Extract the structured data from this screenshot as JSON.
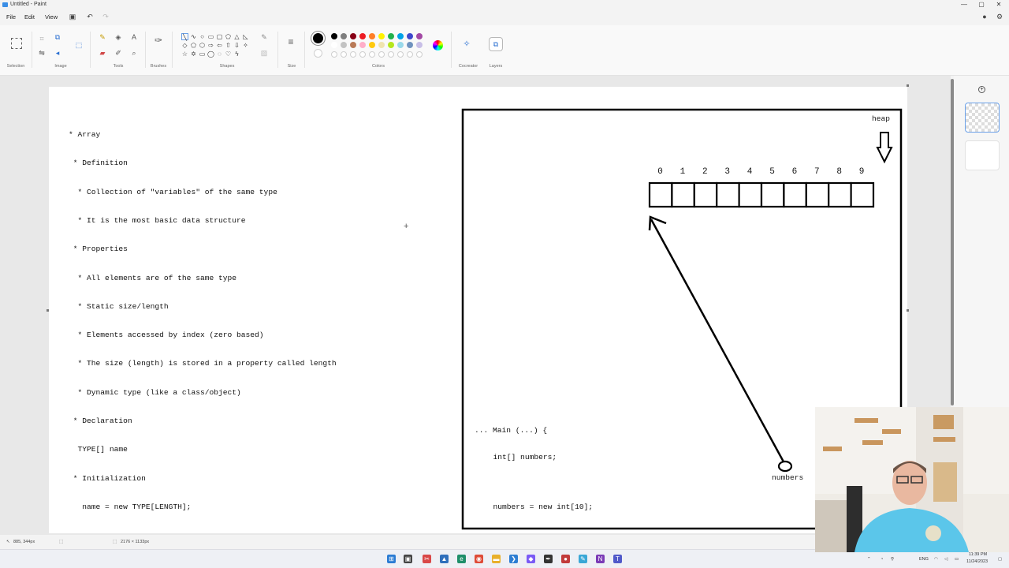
{
  "window": {
    "title": "Untitled - Paint",
    "controls": [
      "—",
      "▢",
      "✕"
    ]
  },
  "menu": {
    "items": [
      "File",
      "Edit",
      "View"
    ]
  },
  "ribbon": {
    "groups": [
      "Selection",
      "Image",
      "Tools",
      "Brushes",
      "Shapes",
      "Size",
      "Colors",
      "Cocreator",
      "Layers"
    ],
    "colors": {
      "primary": "#000000",
      "secondary": "#ffffff",
      "palette_row1": [
        "#000000",
        "#7f7f7f",
        "#880015",
        "#ed1c24",
        "#ff7f27",
        "#fff200",
        "#22b14c",
        "#00a2e8",
        "#3f48cc",
        "#a349a4"
      ],
      "palette_row2": [
        "#ffffff",
        "#c3c3c3",
        "#b97a57",
        "#ffaec9",
        "#ffc90e",
        "#efe4b0",
        "#b5e61d",
        "#99d9ea",
        "#7092be",
        "#c8bfe7"
      ]
    }
  },
  "notes": [
    "* Array",
    " * Definition",
    "  * Collection of \"variables\" of the same type",
    "  * It is the most basic data structure",
    " * Properties",
    "  * All elements are of the same type",
    "  * Static size/length",
    "  * Elements accessed by index (zero based)",
    "  * The size (length) is stored in a property called length",
    "  * Dynamic type (like a class/object)",
    " * Declaration",
    "  TYPE[] name",
    " * Initialization",
    "   name = new TYPE[LENGTH];"
  ],
  "diagram": {
    "heap_label": "heap",
    "indices": [
      "0",
      "1",
      "2",
      "3",
      "4",
      "5",
      "6",
      "7",
      "8",
      "9"
    ],
    "variable_label": "numbers",
    "code": [
      "... Main (...) {",
      "  int[] numbers;",
      "",
      "  numbers = new int[10];"
    ]
  },
  "status": {
    "cursor_pos": "885, 344px",
    "canvas_size": "2176 × 1133px"
  },
  "tray": {
    "language": "ENG",
    "time": "11:39 PM",
    "date": "11/24/2023"
  }
}
